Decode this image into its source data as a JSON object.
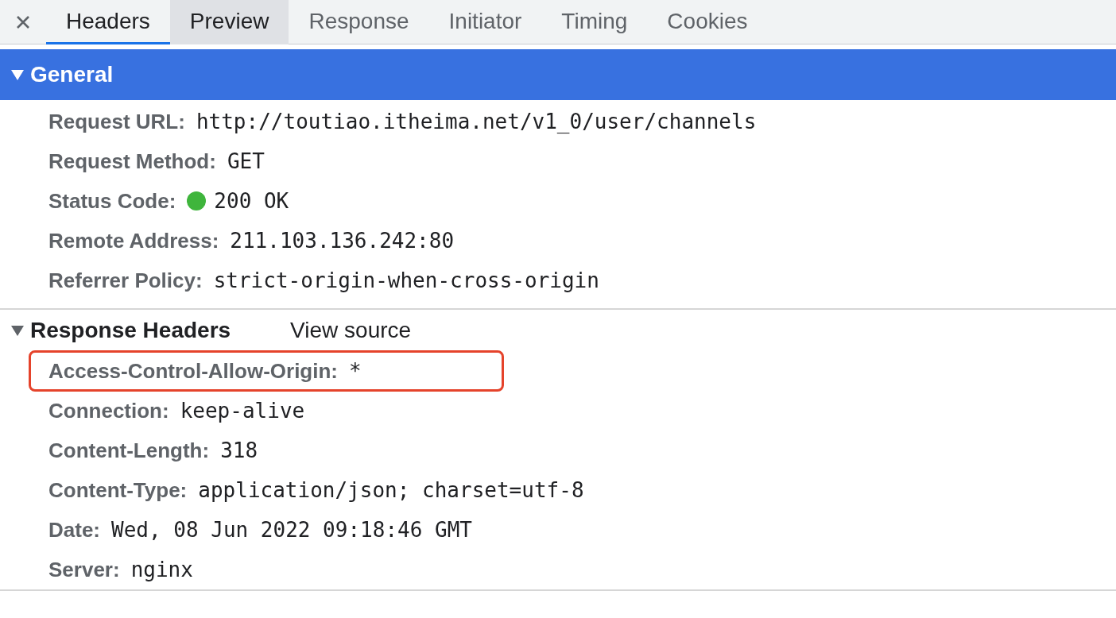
{
  "tabs": [
    {
      "label": "Headers",
      "selected": true,
      "hovered": false
    },
    {
      "label": "Preview",
      "selected": false,
      "hovered": true
    },
    {
      "label": "Response",
      "selected": false,
      "hovered": false
    },
    {
      "label": "Initiator",
      "selected": false,
      "hovered": false
    },
    {
      "label": "Timing",
      "selected": false,
      "hovered": false
    },
    {
      "label": "Cookies",
      "selected": false,
      "hovered": false
    }
  ],
  "sections": [
    {
      "title": "General",
      "expanded": true,
      "selected": true,
      "rows": [
        {
          "name": "Request URL:",
          "value": "http://toutiao.itheima.net/v1_0/user/channels",
          "highlighted": false
        },
        {
          "name": "Request Method:",
          "value": "GET",
          "highlighted": false
        },
        {
          "name": "Status Code:",
          "value": "200 OK",
          "color": "#3fb53c",
          "highlighted": false
        },
        {
          "name": "Remote Address:",
          "value": "211.103.136.242:80",
          "highlighted": false
        },
        {
          "name": "Referrer Policy:",
          "value": "strict-origin-when-cross-origin",
          "highlighted": false
        }
      ]
    },
    {
      "title": "Response Headers",
      "expanded": true,
      "selected": false,
      "link": "View source",
      "rows": [
        {
          "name": "Access-Control-Allow-Origin:",
          "value": "*",
          "highlighted": true
        },
        {
          "name": "Connection:",
          "value": "keep-alive",
          "highlighted": false
        },
        {
          "name": "Content-Length:",
          "value": "318",
          "highlighted": false
        },
        {
          "name": "Content-Type:",
          "value": "application/json; charset=utf-8",
          "highlighted": false
        },
        {
          "name": "Date:",
          "value": "Wed, 08 Jun 2022 09:18:46 GMT",
          "highlighted": false
        },
        {
          "name": "Server:",
          "value": "nginx",
          "highlighted": false
        }
      ]
    }
  ]
}
